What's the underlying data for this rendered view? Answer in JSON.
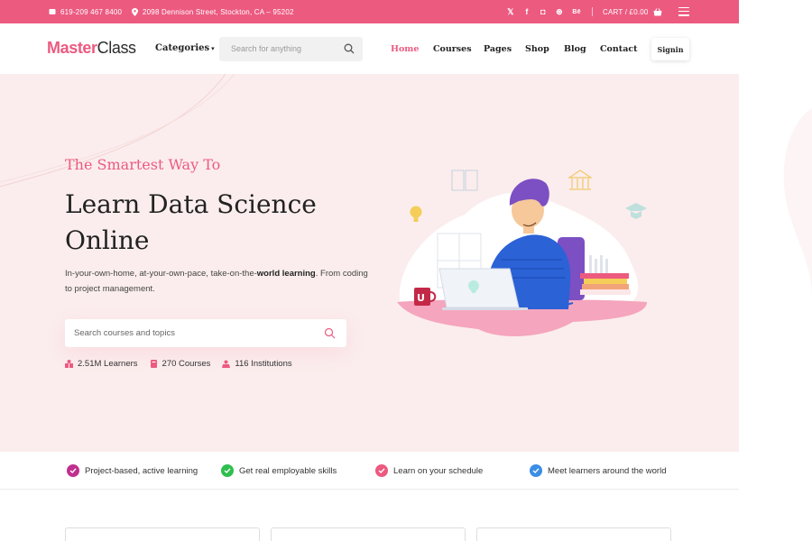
{
  "topbar": {
    "phone": "619-209 467 8400",
    "address": "2098 Dennison Street, Stockton, CA – 95202",
    "social": [
      "twitter-icon",
      "facebook-icon",
      "instagram-icon",
      "pinterest-icon",
      "behance-icon"
    ],
    "social_glyphs": [
      "𝕏",
      "f",
      "◘",
      "⊛",
      "Bē"
    ],
    "cart_label": "CART / £0.00",
    "bg_color": "#ec5a80"
  },
  "header": {
    "logo_part1": "Master",
    "logo_part2": "Class",
    "categories_label": "Categories",
    "search_placeholder": "Search for anything",
    "nav": [
      {
        "label": "Home",
        "active": true
      },
      {
        "label": "Courses",
        "active": false
      },
      {
        "label": "Pages",
        "active": false
      },
      {
        "label": "Shop",
        "active": false
      },
      {
        "label": "Blog",
        "active": false
      },
      {
        "label": "Contact",
        "active": false
      }
    ],
    "signin_label": "Signin"
  },
  "hero": {
    "tagline": "The Smartest Way To",
    "heading_line1": "Learn Data Science",
    "heading_line2": "Online",
    "description_pre": "In-your-own-home, at-your-own-pace, take-on-the-",
    "description_bold": "world learning",
    "description_post": ". From coding to project management.",
    "search_placeholder": "Search courses and topics",
    "stats": [
      {
        "icon": "learners-icon",
        "label": "2.51M Learners"
      },
      {
        "icon": "courses-icon",
        "label": "270 Courses"
      },
      {
        "icon": "institutions-icon",
        "label": "116 Institutions"
      }
    ],
    "accent_color": "#ec5a80",
    "bg_color": "#fbeded"
  },
  "features": [
    {
      "label": "Project-based, active learning",
      "color": "#c0308f"
    },
    {
      "label": "Get real employable skills",
      "color": "#2fbf4f"
    },
    {
      "label": "Learn on your schedule",
      "color": "#ec5a80"
    },
    {
      "label": "Meet learners around the world",
      "color": "#3a8ee6"
    }
  ]
}
